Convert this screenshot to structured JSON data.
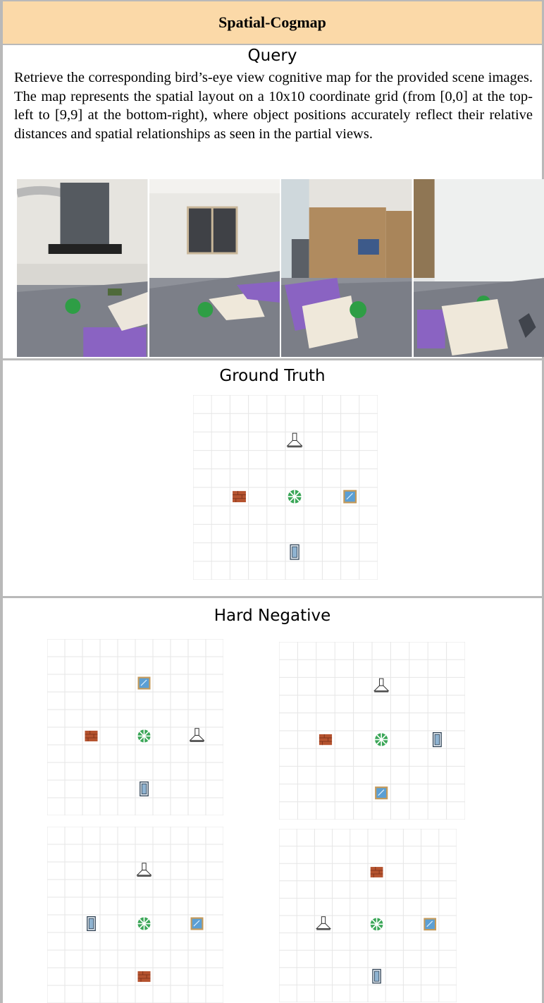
{
  "header": {
    "title": "Spatial-Cogmap"
  },
  "query": {
    "title": "Query",
    "text": "Retrieve the corresponding bird’s-eye view cognitive map for the provided scene images. The map represents the spatial layout on a 10x10 coordinate grid (from [0,0] at the top-left to [9,9] at the bottom-right), where object positions accurately reflect their relative distances and spatial relationships as seen in the partial views."
  },
  "photos": [
    {
      "name": "photo-view-1",
      "scene": "kitchen wall with range hood above bed with green ball"
    },
    {
      "name": "photo-view-2",
      "scene": "window wall beyond bed with green ball"
    },
    {
      "name": "photo-view-3",
      "scene": "cardboard boxes and door beyond bed with green ball"
    },
    {
      "name": "photo-view-4",
      "scene": "white tile wall beyond bed with green ball"
    }
  ],
  "ground_truth": {
    "title": "Ground Truth",
    "map": {
      "grid_size": 10,
      "objects": [
        {
          "icon": "range-hood-icon",
          "col": 5,
          "row": 2
        },
        {
          "icon": "brick-icon",
          "col": 2,
          "row": 5
        },
        {
          "icon": "ball-icon",
          "col": 5,
          "row": 5
        },
        {
          "icon": "window-icon",
          "col": 8,
          "row": 5
        },
        {
          "icon": "door-icon",
          "col": 5,
          "row": 8
        }
      ]
    }
  },
  "hard_negative": {
    "title": "Hard Negative",
    "maps": [
      {
        "grid_size": 10,
        "objects": [
          {
            "icon": "window-icon",
            "col": 5,
            "row": 2
          },
          {
            "icon": "brick-icon",
            "col": 2,
            "row": 5
          },
          {
            "icon": "ball-icon",
            "col": 5,
            "row": 5
          },
          {
            "icon": "range-hood-icon",
            "col": 8,
            "row": 5
          },
          {
            "icon": "door-icon",
            "col": 5,
            "row": 8
          }
        ]
      },
      {
        "grid_size": 10,
        "objects": [
          {
            "icon": "range-hood-icon",
            "col": 5,
            "row": 2
          },
          {
            "icon": "brick-icon",
            "col": 2,
            "row": 5
          },
          {
            "icon": "ball-icon",
            "col": 5,
            "row": 5
          },
          {
            "icon": "door-icon",
            "col": 8,
            "row": 5
          },
          {
            "icon": "window-icon",
            "col": 5,
            "row": 8
          }
        ]
      },
      {
        "grid_size": 10,
        "objects": [
          {
            "icon": "range-hood-icon",
            "col": 5,
            "row": 2
          },
          {
            "icon": "door-icon",
            "col": 2,
            "row": 5
          },
          {
            "icon": "ball-icon",
            "col": 5,
            "row": 5
          },
          {
            "icon": "window-icon",
            "col": 8,
            "row": 5
          },
          {
            "icon": "brick-icon",
            "col": 5,
            "row": 8
          }
        ]
      },
      {
        "grid_size": 10,
        "objects": [
          {
            "icon": "brick-icon",
            "col": 5,
            "row": 2
          },
          {
            "icon": "range-hood-icon",
            "col": 2,
            "row": 5
          },
          {
            "icon": "ball-icon",
            "col": 5,
            "row": 5
          },
          {
            "icon": "window-icon",
            "col": 8,
            "row": 5
          },
          {
            "icon": "door-icon",
            "col": 5,
            "row": 8
          }
        ]
      }
    ]
  },
  "colors": {
    "header_bg": "#fbd9a8",
    "border": "#b9b9b9",
    "grid": "#e6e6e6",
    "ball": "#3aa657",
    "brick": "#b5532f",
    "window": "#5b9fd4"
  }
}
